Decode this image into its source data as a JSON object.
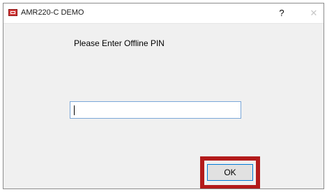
{
  "window": {
    "title": "AMR220-C DEMO",
    "app_icon": "app-logo-icon",
    "help_glyph": "?",
    "close_glyph": "✕"
  },
  "dialog": {
    "prompt": "Please Enter Offline PIN",
    "pin_input": {
      "value": "",
      "placeholder": ""
    },
    "ok_label": "OK"
  },
  "colors": {
    "highlight_border": "#b31b1b",
    "input_border": "#7aa7d8",
    "button_focus_border": "#0078d7",
    "dialog_background": "#f0f0f0"
  }
}
